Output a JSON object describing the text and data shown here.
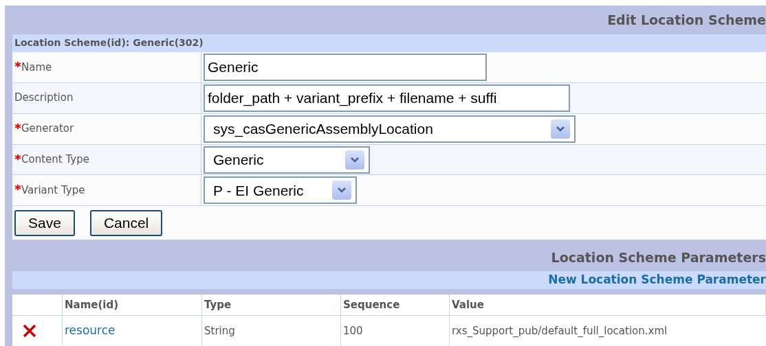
{
  "page_title": "Edit Location Scheme",
  "form": {
    "heading": "Location Scheme(id): Generic(302)",
    "fields": [
      {
        "label": "Name",
        "required": true,
        "kind": "text",
        "value": "Generic"
      },
      {
        "label": "Description",
        "required": false,
        "kind": "text",
        "value": "folder_path + variant_prefix + filename + suffi"
      },
      {
        "label": "Generator",
        "required": true,
        "kind": "select",
        "value": "sys_casGenericAssemblyLocation"
      },
      {
        "label": "Content Type",
        "required": true,
        "kind": "select",
        "value": "Generic"
      },
      {
        "label": "Variant Type",
        "required": true,
        "kind": "select",
        "value": "P - EI Generic"
      }
    ],
    "buttons": [
      "Save",
      "Cancel"
    ]
  },
  "parameters": {
    "title": "Location Scheme Parameters",
    "new_link": "New Location Scheme Parameter",
    "columns": [
      "Name(id)",
      "Type",
      "Sequence",
      "Value"
    ],
    "rows": [
      {
        "name": "resource",
        "type": "String",
        "sequence": "100",
        "value": "rxs_Support_pub/default_full_location.xml"
      }
    ]
  }
}
